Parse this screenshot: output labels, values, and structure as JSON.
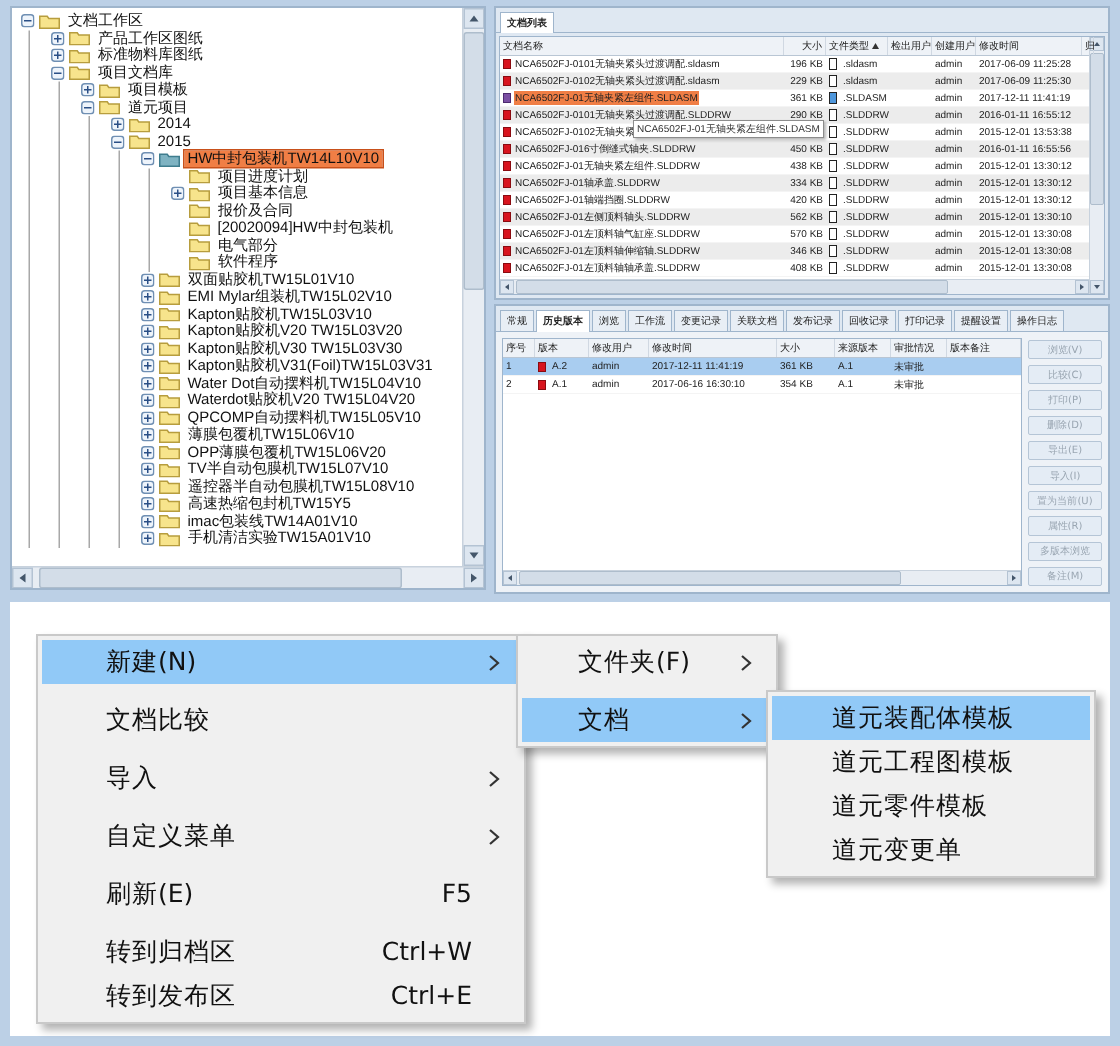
{
  "tree": {
    "items": [
      {
        "label": "文档工作区",
        "expanded": true,
        "selected": false,
        "children": [
          {
            "label": "产品工作区图纸",
            "expanded": false,
            "selected": false
          },
          {
            "label": "标准物料库图纸",
            "expanded": false,
            "selected": false
          },
          {
            "label": "项目文档库",
            "expanded": true,
            "selected": false,
            "children": [
              {
                "label": "项目模板",
                "expanded": false,
                "selected": false
              },
              {
                "label": "道元项目",
                "expanded": true,
                "selected": false,
                "children": [
                  {
                    "label": "2014",
                    "expanded": false,
                    "selected": false
                  },
                  {
                    "label": "2015",
                    "expanded": true,
                    "selected": false,
                    "children": [
                      {
                        "label": "HW中封包装机TW14L10V10",
                        "expanded": true,
                        "selected": true,
                        "children": [
                          {
                            "label": "项目进度计划",
                            "selected": false
                          },
                          {
                            "label": "项目基本信息",
                            "expanded": false,
                            "selected": false
                          },
                          {
                            "label": "报价及合同",
                            "selected": false
                          },
                          {
                            "label": "[20020094]HW中封包装机",
                            "selected": false
                          },
                          {
                            "label": "电气部分",
                            "selected": false
                          },
                          {
                            "label": "软件程序",
                            "selected": false
                          }
                        ]
                      },
                      {
                        "label": "双面贴胶机TW15L01V10",
                        "expanded": false,
                        "selected": false
                      },
                      {
                        "label": "EMI Mylar组装机TW15L02V10",
                        "expanded": false,
                        "selected": false
                      },
                      {
                        "label": "Kapton贴胶机TW15L03V10",
                        "expanded": false,
                        "selected": false
                      },
                      {
                        "label": "Kapton贴胶机V20 TW15L03V20",
                        "expanded": false,
                        "selected": false
                      },
                      {
                        "label": "Kapton贴胶机V30 TW15L03V30",
                        "expanded": false,
                        "selected": false
                      },
                      {
                        "label": "Kapton贴胶机V31(Foil)TW15L03V31",
                        "expanded": false,
                        "selected": false
                      },
                      {
                        "label": "Water Dot自动摆料机TW15L04V10",
                        "expanded": false,
                        "selected": false
                      },
                      {
                        "label": "Waterdot贴胶机V20 TW15L04V20",
                        "expanded": false,
                        "selected": false
                      },
                      {
                        "label": "QPCOMP自动摆料机TW15L05V10",
                        "expanded": false,
                        "selected": false
                      },
                      {
                        "label": "薄膜包覆机TW15L06V10",
                        "expanded": false,
                        "selected": false
                      },
                      {
                        "label": "OPP薄膜包覆机TW15L06V20",
                        "expanded": false,
                        "selected": false
                      },
                      {
                        "label": "TV半自动包膜机TW15L07V10",
                        "expanded": false,
                        "selected": false
                      },
                      {
                        "label": "遥控器半自动包膜机TW15L08V10",
                        "expanded": false,
                        "selected": false
                      },
                      {
                        "label": "高速热缩包封机TW15Y5",
                        "expanded": false,
                        "selected": false
                      },
                      {
                        "label": "imac包装线TW14A01V10",
                        "expanded": false,
                        "selected": false
                      },
                      {
                        "label": "手机清洁实验TW15A01V10",
                        "expanded": false,
                        "selected": false
                      }
                    ]
                  }
                ]
              }
            ]
          }
        ]
      }
    ]
  },
  "document_list": {
    "tab": "文档列表",
    "columns": [
      "文档名称",
      "大小",
      "文件类型",
      "检出用户",
      "创建用户",
      "修改时间",
      "归"
    ],
    "rows": [
      {
        "name": "NCA6502FJ-0101无轴夹紧头过渡调配.sldasm",
        "size": "196 KB",
        "type": ".sldasm",
        "creator": "admin",
        "modified": "2017-06-09 11:25:28",
        "selected": false
      },
      {
        "name": "NCA6502FJ-0102无轴夹紧头过渡调配.sldasm",
        "size": "229 KB",
        "type": ".sldasm",
        "creator": "admin",
        "modified": "2017-06-09 11:25:30",
        "selected": false
      },
      {
        "name": "NCA6502FJ-01无轴夹紧左组件.SLDASM",
        "size": "361 KB",
        "type": ".SLDASM",
        "creator": "admin",
        "modified": "2017-12-11 11:41:19",
        "selected": true
      },
      {
        "name": "NCA6502FJ-0101无轴夹紧头过渡调配.SLDDRW",
        "size": "290 KB",
        "type": ".SLDDRW",
        "creator": "admin",
        "modified": "2016-01-11 16:55:12",
        "selected": false
      },
      {
        "name": "NCA6502FJ-0102无轴夹紧",
        "type": ".SLDDRW",
        "creator": "admin",
        "modified": "2015-12-01 13:53:38",
        "selected": false
      },
      {
        "name": "NCA6502FJ-016寸倒缝式轴夹.SLDDRW",
        "size": "450 KB",
        "type": ".SLDDRW",
        "creator": "admin",
        "modified": "2016-01-11 16:55:56",
        "selected": false
      },
      {
        "name": "NCA6502FJ-01无轴夹紧左组件.SLDDRW",
        "size": "438 KB",
        "type": ".SLDDRW",
        "creator": "admin",
        "modified": "2015-12-01 13:30:12",
        "selected": false
      },
      {
        "name": "NCA6502FJ-01轴承盖.SLDDRW",
        "size": "334 KB",
        "type": ".SLDDRW",
        "creator": "admin",
        "modified": "2015-12-01 13:30:12",
        "selected": false
      },
      {
        "name": "NCA6502FJ-01轴端挡圈.SLDDRW",
        "size": "420 KB",
        "type": ".SLDDRW",
        "creator": "admin",
        "modified": "2015-12-01 13:30:12",
        "selected": false
      },
      {
        "name": "NCA6502FJ-01左侧顶料轴头.SLDDRW",
        "size": "562 KB",
        "type": ".SLDDRW",
        "creator": "admin",
        "modified": "2015-12-01 13:30:10",
        "selected": false
      },
      {
        "name": "NCA6502FJ-01左顶料轴气缸座.SLDDRW",
        "size": "570 KB",
        "type": ".SLDDRW",
        "creator": "admin",
        "modified": "2015-12-01 13:30:08",
        "selected": false
      },
      {
        "name": "NCA6502FJ-01左顶料轴伸缩轴.SLDDRW",
        "size": "346 KB",
        "type": ".SLDDRW",
        "creator": "admin",
        "modified": "2015-12-01 13:30:08",
        "selected": false
      },
      {
        "name": "NCA6502FJ-01左顶料轴轴承盖.SLDDRW",
        "size": "408 KB",
        "type": ".SLDDRW",
        "creator": "admin",
        "modified": "2015-12-01 13:30:08",
        "selected": false
      }
    ],
    "tooltip": "NCA6502FJ-01无轴夹紧左组件.SLDASM"
  },
  "detail": {
    "tabs": [
      {
        "label": "常规",
        "selected": false
      },
      {
        "label": "历史版本",
        "selected": true
      },
      {
        "label": "浏览",
        "selected": false
      },
      {
        "label": "工作流",
        "selected": false
      },
      {
        "label": "变更记录",
        "selected": false
      },
      {
        "label": "关联文档",
        "selected": false
      },
      {
        "label": "发布记录",
        "selected": false
      },
      {
        "label": "回收记录",
        "selected": false
      },
      {
        "label": "打印记录",
        "selected": false
      },
      {
        "label": "提醒设置",
        "selected": false
      },
      {
        "label": "操作日志",
        "selected": false
      }
    ],
    "columns": [
      "序号",
      "版本",
      "修改用户",
      "修改时间",
      "大小",
      "来源版本",
      "审批情况",
      "版本备注"
    ],
    "rows": [
      {
        "index": "1",
        "version": "A.2",
        "user": "admin",
        "modified": "2017-12-11 11:41:19",
        "size": "361 KB",
        "source": "A.1",
        "approval": "未审批",
        "selected": true
      },
      {
        "index": "2",
        "version": "A.1",
        "user": "admin",
        "modified": "2017-06-16 16:30:10",
        "size": "354 KB",
        "source": "A.1",
        "approval": "未审批",
        "selected": false
      }
    ],
    "buttons": [
      {
        "label": "浏览(V)",
        "disabled": true
      },
      {
        "label": "比较(C)",
        "disabled": true
      },
      {
        "label": "打印(P)",
        "disabled": true
      },
      {
        "label": "删除(D)",
        "disabled": true
      },
      {
        "label": "导出(E)",
        "disabled": true
      },
      {
        "label": "导入(I)",
        "disabled": true
      },
      {
        "label": "置为当前(U)",
        "disabled": true
      },
      {
        "label": "属性(R)",
        "disabled": true
      },
      {
        "label": "多版本浏览",
        "disabled": true
      },
      {
        "label": "备注(M)",
        "disabled": true
      }
    ]
  },
  "context_menu": {
    "items": [
      {
        "label": "新建(N)",
        "submenu": true,
        "selected": true,
        "divider_after": true
      },
      {
        "label": "文档比较",
        "submenu": false,
        "selected": false,
        "divider_after": true
      },
      {
        "label": "导入",
        "submenu": true,
        "selected": false,
        "divider_after": true
      },
      {
        "label": "自定义菜单",
        "submenu": true,
        "selected": false,
        "divider_after": true
      },
      {
        "label": "刷新(E)",
        "shortcut": "F5",
        "submenu": false,
        "selected": false,
        "divider_after": true
      },
      {
        "label": "转到归档区",
        "shortcut": "Ctrl+W",
        "submenu": false,
        "selected": false,
        "divider_after": false
      },
      {
        "label": "转到发布区",
        "shortcut": "Ctrl+E",
        "submenu": false,
        "selected": false,
        "divider_after": false
      }
    ]
  },
  "submenu_new": {
    "items": [
      {
        "label": "文件夹(F)",
        "submenu": true,
        "selected": false,
        "divider_after": true
      },
      {
        "label": "文档",
        "submenu": true,
        "selected": true,
        "divider_after": false
      }
    ]
  },
  "submenu_document": {
    "items": [
      {
        "label": "道元装配体模板",
        "submenu": false,
        "selected": true,
        "divider_after": false
      },
      {
        "label": "道元工程图模板",
        "submenu": false,
        "selected": false,
        "divider_after": false
      },
      {
        "label": "道元零件模板",
        "submenu": false,
        "selected": false,
        "divider_after": false
      },
      {
        "label": "道元变更单",
        "submenu": false,
        "selected": false,
        "divider_after": false
      }
    ]
  }
}
